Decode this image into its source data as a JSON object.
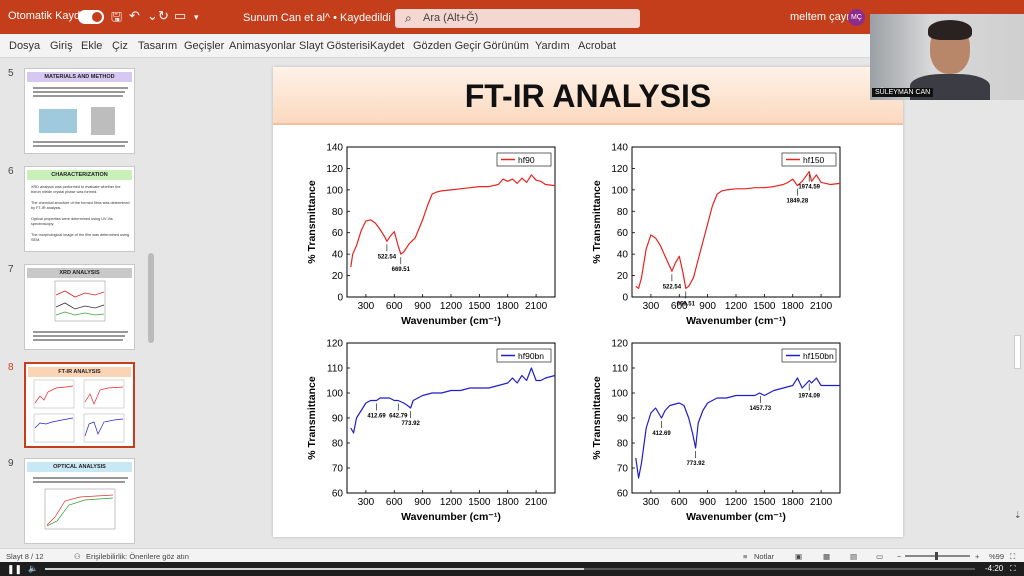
{
  "titlebar": {
    "autosave_label": "Otomatik Kaydet",
    "doc_title": "Sunum Can et al^ • Kaydedildi  ⌄",
    "search_placeholder": "Ara (Alt+Ğ)",
    "user_name": "meltem çayırlı",
    "user_initials": "MÇ"
  },
  "menu": [
    "Dosya",
    "Giriş",
    "Ekle",
    "Çiz",
    "Tasarım",
    "Geçişler",
    "Animasyonlar",
    "Slayt Gösterisi",
    "Kaydet",
    "Gözden Geçir",
    "Görünüm",
    "Yardım",
    "Acrobat"
  ],
  "thumbnails": [
    {
      "num": "5",
      "title": "MATERIALS AND METHOD",
      "color": "#d6c8f0"
    },
    {
      "num": "6",
      "title": "CHARACTERIZATION",
      "color": "#c9f0b8",
      "bullets": [
        "XRD analysis was performed to evaluate whether the boron nitride crystal phase was formed.",
        "The chemical structure of the formed films was determined by FT-IR analysis.",
        "Optical properties were determined using UV-Vis spectroscopy.",
        "The morphological image of the film was determined using SEM."
      ]
    },
    {
      "num": "7",
      "title": "XRD ANALYSIS",
      "color": "#c8c8c8"
    },
    {
      "num": "8",
      "title": "FT-IR ANALYSIS",
      "color": "#fbd3b5"
    },
    {
      "num": "9",
      "title": "OPTICAL ANALYSIS",
      "color": "#c9e8f5"
    }
  ],
  "slide": {
    "title": "FT-IR ANALYSIS"
  },
  "webcam": {
    "name": "SÜLEYMAN CAN"
  },
  "colors": {
    "accent": "#c43e1c",
    "red_series": "#e8231f",
    "blue_series": "#1f1fc8"
  },
  "statusbar": {
    "slide_pos": "Slayt 8 / 12",
    "accessibility": "Erişilebilirlik: Önerilere göz atın",
    "notes": "Notlar",
    "zoom": "%99"
  },
  "videobar": {
    "time": "-4:20",
    "progress": 0.58
  },
  "chart_data": [
    {
      "type": "line",
      "legend": "hf90",
      "xlabel": "Wavenumber (cm⁻¹)",
      "ylabel": "% Transmittance",
      "xlim": [
        100,
        2300
      ],
      "ylim": [
        0,
        140
      ],
      "xticks": [
        300,
        600,
        900,
        1200,
        1500,
        1800,
        2100
      ],
      "yticks": [
        0,
        20,
        40,
        60,
        80,
        100,
        120,
        140
      ],
      "series": [
        {
          "name": "hf90",
          "x": [
            140,
            160,
            200,
            250,
            300,
            350,
            400,
            450,
            500,
            522,
            560,
            600,
            640,
            669,
            700,
            760,
            820,
            900,
            950,
            1000,
            1050,
            1100,
            1200,
            1300,
            1400,
            1500,
            1600,
            1700,
            1750,
            1800,
            1850,
            1900,
            1950,
            2000,
            2050,
            2100,
            2150,
            2200,
            2300
          ],
          "y": [
            28,
            40,
            48,
            62,
            71,
            72,
            69,
            63,
            56,
            52,
            57,
            61,
            48,
            40,
            42,
            50,
            55,
            72,
            85,
            96,
            98,
            99,
            100,
            101,
            102,
            103,
            103,
            105,
            110,
            108,
            110,
            106,
            111,
            107,
            114,
            109,
            108,
            105,
            104
          ]
        }
      ],
      "annotations": [
        {
          "text": "522.54",
          "x": 522,
          "y": 52
        },
        {
          "text": "669.51",
          "x": 669,
          "y": 40
        }
      ]
    },
    {
      "type": "line",
      "legend": "hf150",
      "xlabel": "Wavenumber (cm⁻¹)",
      "ylabel": "% Transmittance",
      "xlim": [
        100,
        2300
      ],
      "ylim": [
        0,
        140
      ],
      "xticks": [
        300,
        600,
        900,
        1200,
        1500,
        1800,
        2100
      ],
      "yticks": [
        0,
        20,
        40,
        60,
        80,
        100,
        120,
        140
      ],
      "series": [
        {
          "name": "hf150",
          "x": [
            140,
            170,
            200,
            250,
            300,
            350,
            400,
            450,
            522,
            560,
            600,
            640,
            669,
            700,
            750,
            800,
            900,
            950,
            1000,
            1050,
            1100,
            1200,
            1300,
            1400,
            1500,
            1600,
            1700,
            1750,
            1800,
            1849,
            1900,
            1974,
            2000,
            2050,
            2100,
            2150,
            2200,
            2300
          ],
          "y": [
            10,
            8,
            18,
            45,
            58,
            55,
            48,
            38,
            24,
            32,
            38,
            22,
            8,
            10,
            18,
            35,
            68,
            85,
            96,
            99,
            100,
            101,
            101,
            102,
            102,
            103,
            105,
            107,
            110,
            104,
            108,
            117,
            108,
            114,
            107,
            106,
            105,
            106
          ]
        }
      ],
      "annotations": [
        {
          "text": "522.54",
          "x": 522,
          "y": 24
        },
        {
          "text": "669.51",
          "x": 669,
          "y": 8
        },
        {
          "text": "1974.59",
          "x": 1974,
          "y": 117
        },
        {
          "text": "1849.28",
          "x": 1849,
          "y": 104
        }
      ]
    },
    {
      "type": "line",
      "legend": "hf90bn",
      "xlabel": "Wavenumber (cm⁻¹)",
      "ylabel": "% Transmittance",
      "xlim": [
        100,
        2300
      ],
      "ylim": [
        60,
        120
      ],
      "xticks": [
        300,
        600,
        900,
        1200,
        1500,
        1800,
        2100
      ],
      "yticks": [
        60,
        70,
        80,
        90,
        100,
        110,
        120
      ],
      "series": [
        {
          "name": "hf90bn",
          "x": [
            140,
            170,
            200,
            250,
            300,
            350,
            412,
            450,
            500,
            550,
            600,
            642,
            700,
            740,
            773,
            800,
            850,
            900,
            1000,
            1100,
            1200,
            1300,
            1400,
            1500,
            1600,
            1700,
            1800,
            1850,
            1900,
            1950,
            2000,
            2050,
            2100,
            2150,
            2200,
            2300
          ],
          "y": [
            86,
            84,
            90,
            93,
            96,
            97,
            97,
            98,
            98,
            98,
            97,
            97,
            96,
            95,
            94,
            97,
            98,
            99,
            100,
            100,
            101,
            101,
            102,
            102,
            102,
            103,
            104,
            106,
            104,
            107,
            105,
            110,
            105,
            105,
            106,
            107
          ]
        }
      ],
      "annotations": [
        {
          "text": "412.69",
          "x": 412,
          "y": 97
        },
        {
          "text": "642.79",
          "x": 642,
          "y": 97
        },
        {
          "text": "773.92",
          "x": 773,
          "y": 94
        }
      ]
    },
    {
      "type": "line",
      "legend": "hf150bn",
      "xlabel": "Wavenumber (cm⁻¹)",
      "ylabel": "% Transmittance",
      "xlim": [
        100,
        2300
      ],
      "ylim": [
        60,
        120
      ],
      "xticks": [
        300,
        600,
        900,
        1200,
        1500,
        1800,
        2100
      ],
      "yticks": [
        60,
        70,
        80,
        90,
        100,
        110,
        120
      ],
      "series": [
        {
          "name": "hf150bn",
          "x": [
            140,
            170,
            200,
            250,
            300,
            350,
            412,
            450,
            500,
            600,
            650,
            700,
            740,
            773,
            800,
            850,
            900,
            1000,
            1100,
            1200,
            1300,
            1400,
            1450,
            1500,
            1550,
            1600,
            1700,
            1800,
            1850,
            1900,
            1974,
            2000,
            2050,
            2100,
            2200,
            2300
          ],
          "y": [
            74,
            66,
            72,
            86,
            92,
            94,
            90,
            93,
            95,
            96,
            95,
            90,
            84,
            78,
            88,
            93,
            96,
            98,
            98,
            99,
            99,
            99,
            100,
            99,
            100,
            101,
            102,
            103,
            106,
            102,
            105,
            104,
            106,
            103,
            103,
            103
          ]
        }
      ],
      "annotations": [
        {
          "text": "412.69",
          "x": 412,
          "y": 90
        },
        {
          "text": "773.92",
          "x": 773,
          "y": 78
        },
        {
          "text": "1974.09",
          "x": 1974,
          "y": 105
        },
        {
          "text": "1457.73",
          "x": 1457,
          "y": 100
        }
      ]
    }
  ]
}
